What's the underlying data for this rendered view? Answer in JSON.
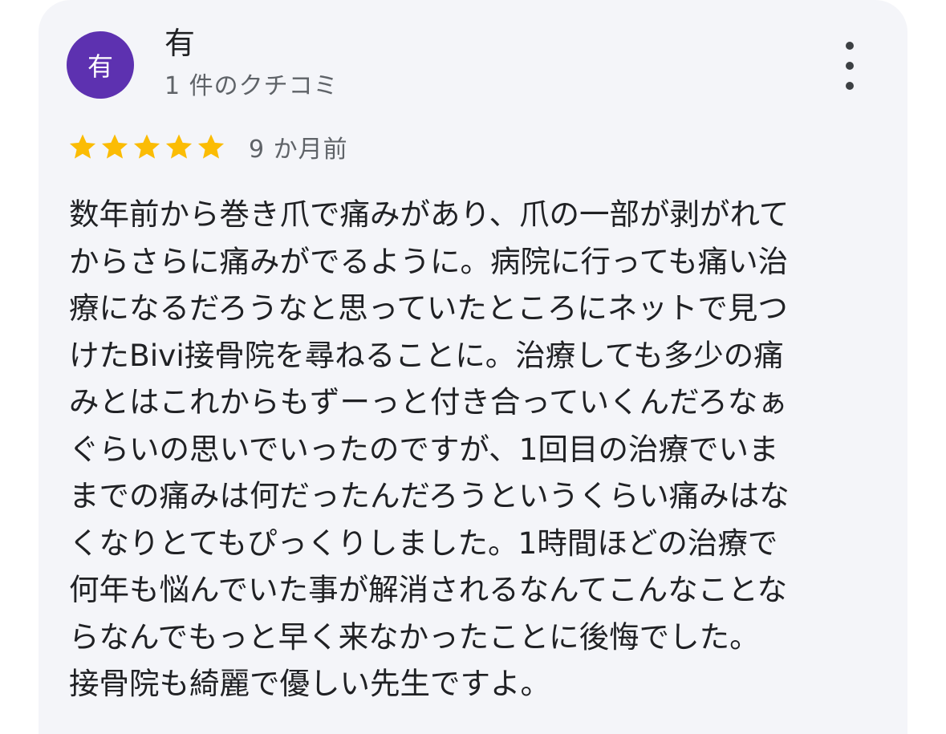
{
  "review": {
    "author_initial": "有",
    "author_name": "有",
    "review_count": "1 件のクチコミ",
    "rating": 5,
    "rating_max": 5,
    "time": "9 か月前",
    "lines": [
      "数年前から巻き爪で痛みがあり、爪の一部が剥がれて",
      "からさらに痛みがでるように。病院に行っても痛い治",
      "療になるだろうなと思っていたところにネットで見つ",
      "けたBivi接骨院を尋ねることに。治療しても多少の痛",
      "みとはこれからもずーっと付き合っていくんだろなぁ",
      "ぐらいの思いでいったのですが、1回目の治療でいま",
      "までの痛みは何だったんだろうというくらい痛みはな",
      "くなりとてもぴっくりしました。1時間ほどの治療で",
      "何年も悩んでいた事が解消されるなんてこんなことな",
      "らなんでもっと早く来なかったことに後悔でした。",
      "接骨院も綺麗で優しい先生ですよ。"
    ]
  },
  "icons": {
    "more": "more-vert-icon",
    "star": "star-icon"
  },
  "colors": {
    "avatar_bg": "#5d31b0",
    "star": "#fbbc04",
    "card_bg": "#f4f5f9",
    "text_primary": "#202124",
    "text_secondary": "#5f6368"
  }
}
